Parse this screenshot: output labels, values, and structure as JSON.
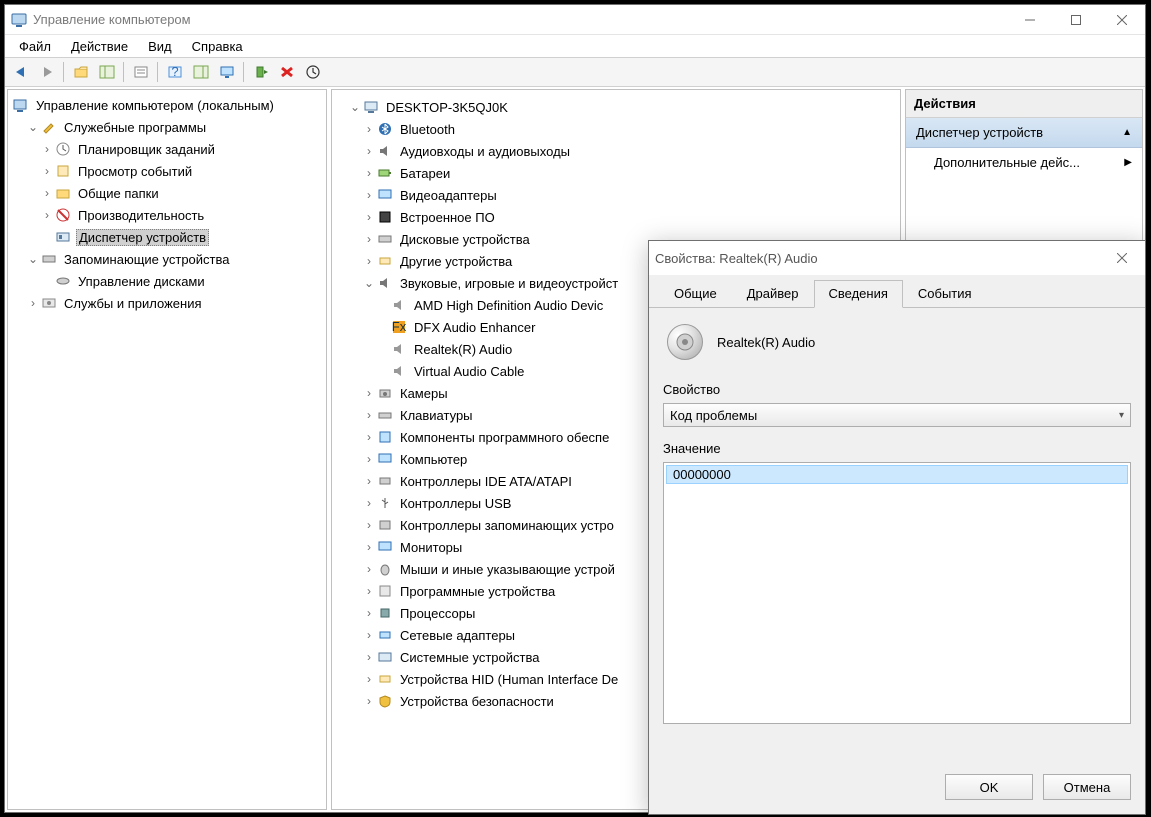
{
  "main": {
    "title": "Управление компьютером",
    "menu": {
      "file": "Файл",
      "action": "Действие",
      "view": "Вид",
      "help": "Справка"
    }
  },
  "left_tree": {
    "root": "Управление компьютером (локальным)",
    "serv": "Служебные программы",
    "serv_children": [
      "Планировщик заданий",
      "Просмотр событий",
      "Общие папки",
      "Производительность",
      "Диспетчер устройств"
    ],
    "storage": "Запоминающие устройства",
    "storage_children": [
      "Управление дисками"
    ],
    "services": "Службы и приложения"
  },
  "mid_tree": {
    "host": "DESKTOP-3K5QJ0K",
    "cats": [
      "Bluetooth",
      "Аудиовходы и аудиовыходы",
      "Батареи",
      "Видеоадаптеры",
      "Встроенное ПО",
      "Дисковые устройства",
      "Другие устройства",
      "Звуковые, игровые и видеоустройст",
      "Камеры",
      "Клавиатуры",
      "Компоненты программного обеспе",
      "Компьютер",
      "Контроллеры IDE ATA/ATAPI",
      "Контроллеры USB",
      "Контроллеры запоминающих устро",
      "Мониторы",
      "Мыши и иные указывающие устрой",
      "Программные устройства",
      "Процессоры",
      "Сетевые адаптеры",
      "Системные устройства",
      "Устройства HID (Human Interface De",
      "Устройства безопасности"
    ],
    "audio_children": [
      "AMD High Definition Audio Devic",
      "DFX Audio Enhancer",
      "Realtek(R) Audio",
      "Virtual Audio Cable"
    ]
  },
  "actions": {
    "header": "Действия",
    "row1": "Диспетчер устройств",
    "row2": "Дополнительные дейс..."
  },
  "dialog": {
    "title": "Свойства: Realtek(R) Audio",
    "tabs": [
      "Общие",
      "Драйвер",
      "Сведения",
      "События"
    ],
    "active_tab_index": 2,
    "device_name": "Realtek(R) Audio",
    "label_property": "Свойство",
    "combo_value": "Код проблемы",
    "label_value": "Значение",
    "list_value": "00000000",
    "btn_ok": "OK",
    "btn_cancel": "Отмена"
  }
}
